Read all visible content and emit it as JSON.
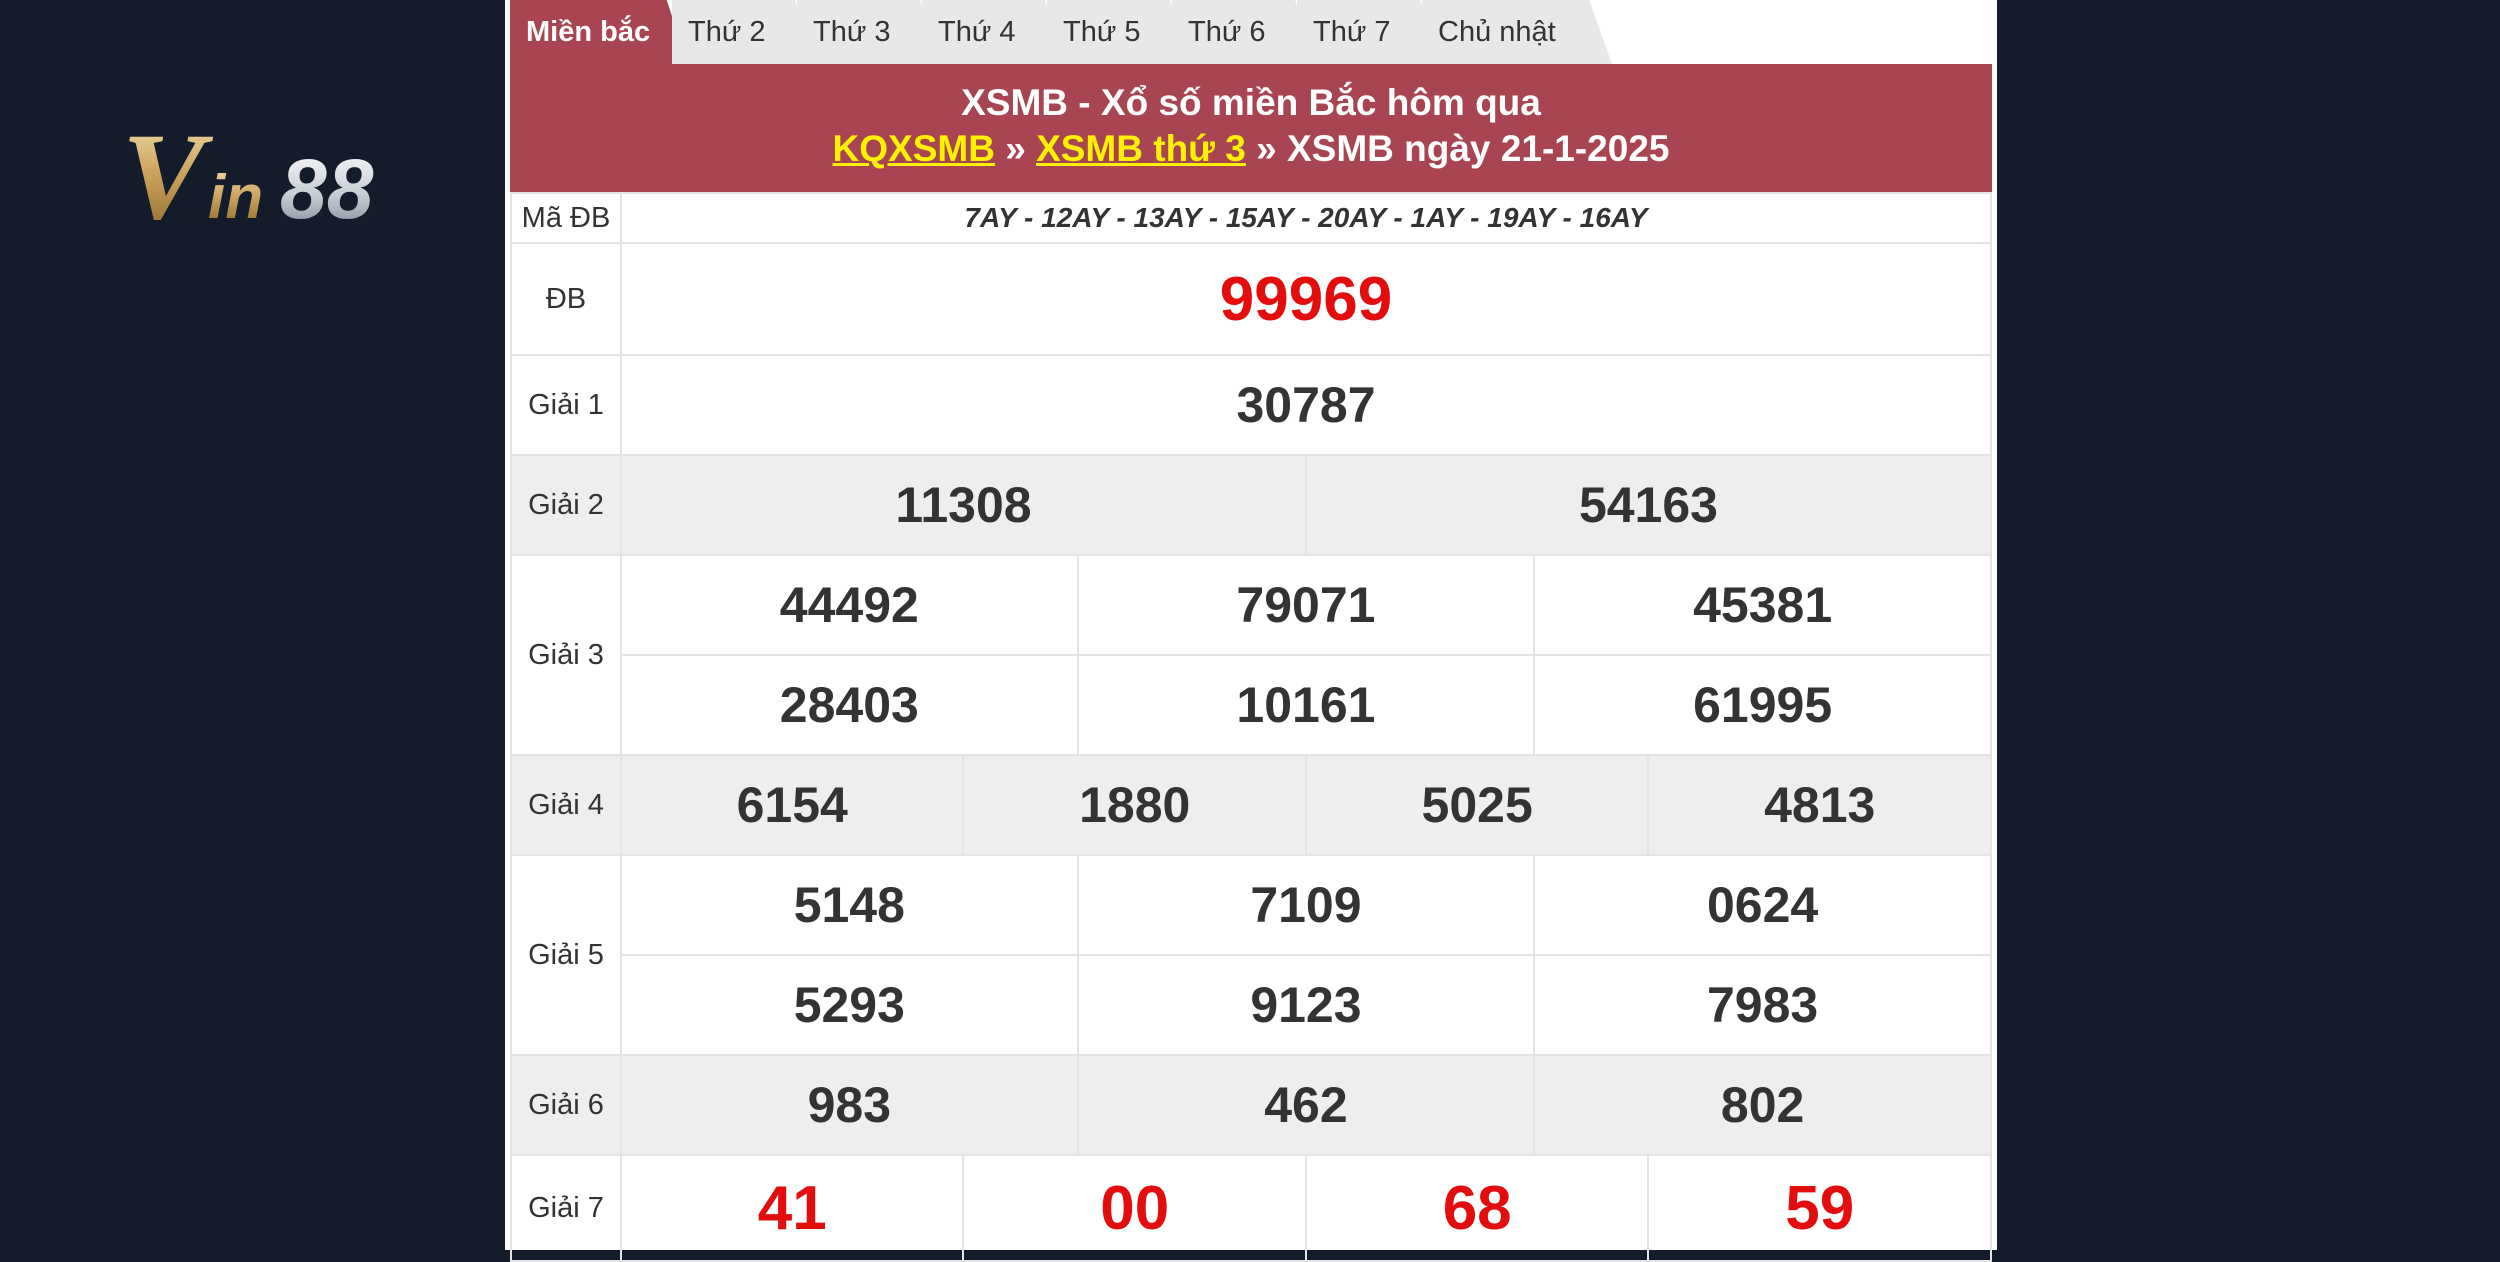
{
  "brand": {
    "logo_text": "Vin88"
  },
  "tabs": [
    {
      "label": "Miền bắc",
      "active": true
    },
    {
      "label": "Thứ 2"
    },
    {
      "label": "Thứ 3"
    },
    {
      "label": "Thứ 4"
    },
    {
      "label": "Thứ 5"
    },
    {
      "label": "Thứ 6"
    },
    {
      "label": "Thứ 7"
    },
    {
      "label": "Chủ nhật"
    }
  ],
  "header": {
    "title": "XSMB - Xổ số miền Bắc hôm qua",
    "crumb1": "KQXSMB",
    "sep1": " » ",
    "crumb2": "XSMB thứ 3",
    "sep2": " » ",
    "current": "XSMB ngày 21-1-2025"
  },
  "results": {
    "code_label": "Mã ĐB",
    "codes": "7AY - 12AY - 13AY - 15AY - 20AY - 1AY - 19AY - 16AY",
    "db": {
      "label": "ĐB",
      "numbers": [
        "99969"
      ]
    },
    "g1": {
      "label": "Giải 1",
      "numbers": [
        "30787"
      ]
    },
    "g2": {
      "label": "Giải 2",
      "numbers": [
        "11308",
        "54163"
      ]
    },
    "g3": {
      "label": "Giải 3",
      "numbers": [
        "44492",
        "79071",
        "45381",
        "28403",
        "10161",
        "61995"
      ]
    },
    "g4": {
      "label": "Giải 4",
      "numbers": [
        "6154",
        "1880",
        "5025",
        "4813"
      ]
    },
    "g5": {
      "label": "Giải 5",
      "numbers": [
        "5148",
        "7109",
        "0624",
        "5293",
        "9123",
        "7983"
      ]
    },
    "g6": {
      "label": "Giải 6",
      "numbers": [
        "983",
        "462",
        "802"
      ]
    },
    "g7": {
      "label": "Giải 7",
      "numbers": [
        "41",
        "00",
        "68",
        "59"
      ]
    }
  },
  "colors": {
    "page_bg": "#141c2b",
    "header_bg": "#a94452",
    "link": "#fff200",
    "highlight_red": "#e30d0d"
  }
}
